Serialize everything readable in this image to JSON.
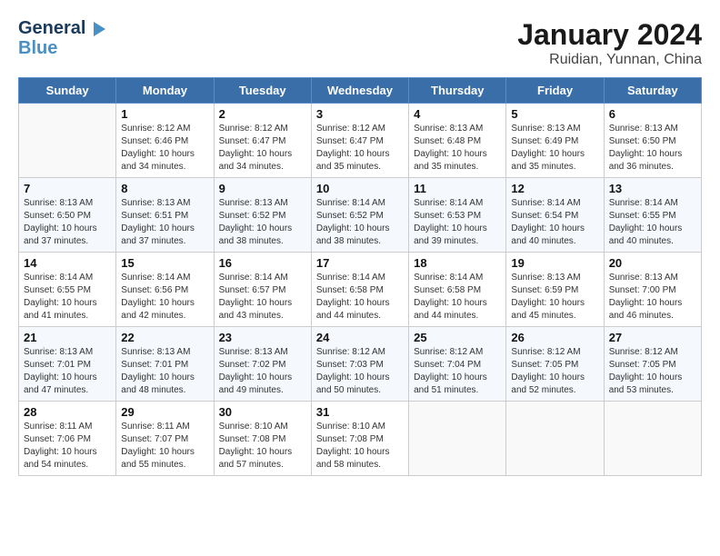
{
  "header": {
    "logo_line1": "General",
    "logo_line2": "Blue",
    "title": "January 2024",
    "subtitle": "Ruidian, Yunnan, China"
  },
  "weekdays": [
    "Sunday",
    "Monday",
    "Tuesday",
    "Wednesday",
    "Thursday",
    "Friday",
    "Saturday"
  ],
  "weeks": [
    [
      {
        "day": "",
        "info": ""
      },
      {
        "day": "1",
        "info": "Sunrise: 8:12 AM\nSunset: 6:46 PM\nDaylight: 10 hours\nand 34 minutes."
      },
      {
        "day": "2",
        "info": "Sunrise: 8:12 AM\nSunset: 6:47 PM\nDaylight: 10 hours\nand 34 minutes."
      },
      {
        "day": "3",
        "info": "Sunrise: 8:12 AM\nSunset: 6:47 PM\nDaylight: 10 hours\nand 35 minutes."
      },
      {
        "day": "4",
        "info": "Sunrise: 8:13 AM\nSunset: 6:48 PM\nDaylight: 10 hours\nand 35 minutes."
      },
      {
        "day": "5",
        "info": "Sunrise: 8:13 AM\nSunset: 6:49 PM\nDaylight: 10 hours\nand 35 minutes."
      },
      {
        "day": "6",
        "info": "Sunrise: 8:13 AM\nSunset: 6:50 PM\nDaylight: 10 hours\nand 36 minutes."
      }
    ],
    [
      {
        "day": "7",
        "info": "Sunrise: 8:13 AM\nSunset: 6:50 PM\nDaylight: 10 hours\nand 37 minutes."
      },
      {
        "day": "8",
        "info": "Sunrise: 8:13 AM\nSunset: 6:51 PM\nDaylight: 10 hours\nand 37 minutes."
      },
      {
        "day": "9",
        "info": "Sunrise: 8:13 AM\nSunset: 6:52 PM\nDaylight: 10 hours\nand 38 minutes."
      },
      {
        "day": "10",
        "info": "Sunrise: 8:14 AM\nSunset: 6:52 PM\nDaylight: 10 hours\nand 38 minutes."
      },
      {
        "day": "11",
        "info": "Sunrise: 8:14 AM\nSunset: 6:53 PM\nDaylight: 10 hours\nand 39 minutes."
      },
      {
        "day": "12",
        "info": "Sunrise: 8:14 AM\nSunset: 6:54 PM\nDaylight: 10 hours\nand 40 minutes."
      },
      {
        "day": "13",
        "info": "Sunrise: 8:14 AM\nSunset: 6:55 PM\nDaylight: 10 hours\nand 40 minutes."
      }
    ],
    [
      {
        "day": "14",
        "info": "Sunrise: 8:14 AM\nSunset: 6:55 PM\nDaylight: 10 hours\nand 41 minutes."
      },
      {
        "day": "15",
        "info": "Sunrise: 8:14 AM\nSunset: 6:56 PM\nDaylight: 10 hours\nand 42 minutes."
      },
      {
        "day": "16",
        "info": "Sunrise: 8:14 AM\nSunset: 6:57 PM\nDaylight: 10 hours\nand 43 minutes."
      },
      {
        "day": "17",
        "info": "Sunrise: 8:14 AM\nSunset: 6:58 PM\nDaylight: 10 hours\nand 44 minutes."
      },
      {
        "day": "18",
        "info": "Sunrise: 8:14 AM\nSunset: 6:58 PM\nDaylight: 10 hours\nand 44 minutes."
      },
      {
        "day": "19",
        "info": "Sunrise: 8:13 AM\nSunset: 6:59 PM\nDaylight: 10 hours\nand 45 minutes."
      },
      {
        "day": "20",
        "info": "Sunrise: 8:13 AM\nSunset: 7:00 PM\nDaylight: 10 hours\nand 46 minutes."
      }
    ],
    [
      {
        "day": "21",
        "info": "Sunrise: 8:13 AM\nSunset: 7:01 PM\nDaylight: 10 hours\nand 47 minutes."
      },
      {
        "day": "22",
        "info": "Sunrise: 8:13 AM\nSunset: 7:01 PM\nDaylight: 10 hours\nand 48 minutes."
      },
      {
        "day": "23",
        "info": "Sunrise: 8:13 AM\nSunset: 7:02 PM\nDaylight: 10 hours\nand 49 minutes."
      },
      {
        "day": "24",
        "info": "Sunrise: 8:12 AM\nSunset: 7:03 PM\nDaylight: 10 hours\nand 50 minutes."
      },
      {
        "day": "25",
        "info": "Sunrise: 8:12 AM\nSunset: 7:04 PM\nDaylight: 10 hours\nand 51 minutes."
      },
      {
        "day": "26",
        "info": "Sunrise: 8:12 AM\nSunset: 7:05 PM\nDaylight: 10 hours\nand 52 minutes."
      },
      {
        "day": "27",
        "info": "Sunrise: 8:12 AM\nSunset: 7:05 PM\nDaylight: 10 hours\nand 53 minutes."
      }
    ],
    [
      {
        "day": "28",
        "info": "Sunrise: 8:11 AM\nSunset: 7:06 PM\nDaylight: 10 hours\nand 54 minutes."
      },
      {
        "day": "29",
        "info": "Sunrise: 8:11 AM\nSunset: 7:07 PM\nDaylight: 10 hours\nand 55 minutes."
      },
      {
        "day": "30",
        "info": "Sunrise: 8:10 AM\nSunset: 7:08 PM\nDaylight: 10 hours\nand 57 minutes."
      },
      {
        "day": "31",
        "info": "Sunrise: 8:10 AM\nSunset: 7:08 PM\nDaylight: 10 hours\nand 58 minutes."
      },
      {
        "day": "",
        "info": ""
      },
      {
        "day": "",
        "info": ""
      },
      {
        "day": "",
        "info": ""
      }
    ]
  ]
}
